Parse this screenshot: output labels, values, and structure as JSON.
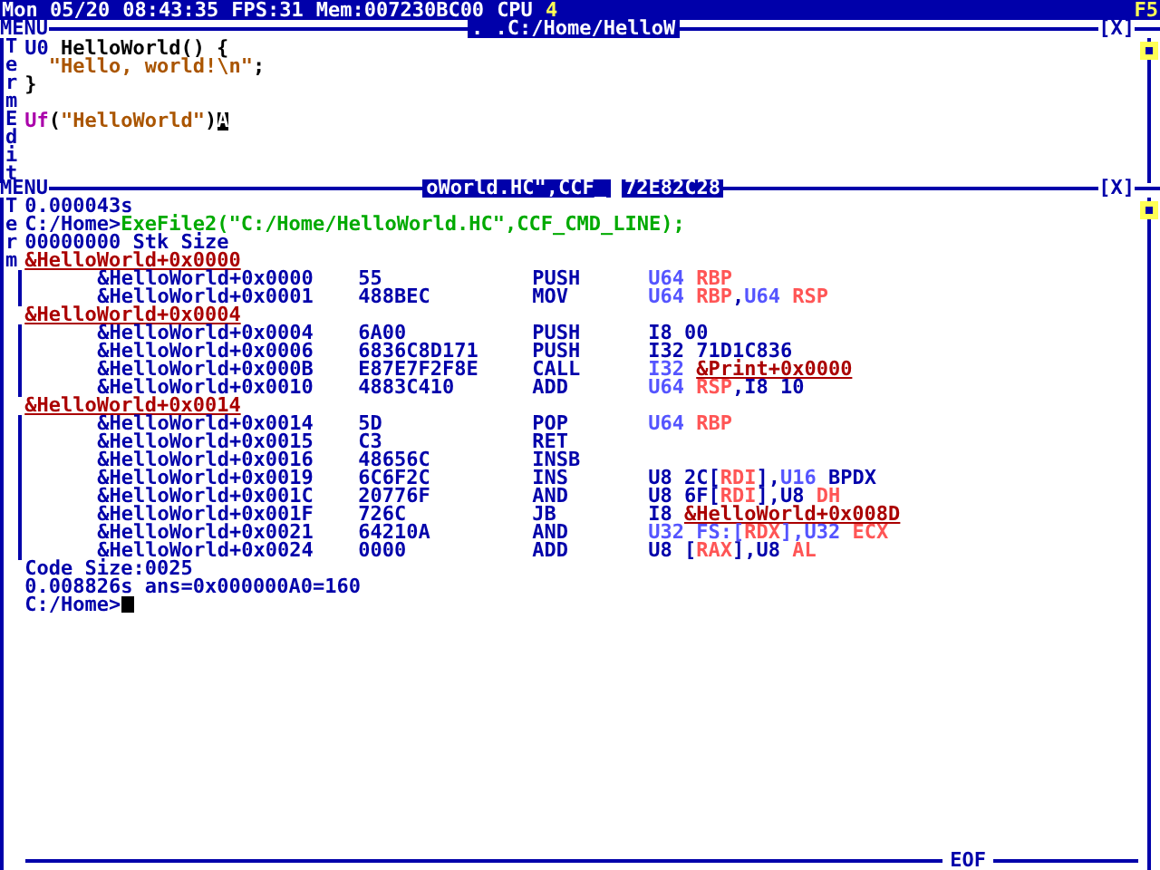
{
  "status_bar": {
    "date": "Mon 05/20",
    "time": "08:43:35",
    "fps": "FPS:31",
    "mem": "Mem:007230BC00",
    "cpu_label": "CPU",
    "cpu_count": "4",
    "right": "F5"
  },
  "editor_window": {
    "menu": "MENU",
    "title": ". .C:/Home/HelloW",
    "close": "[X]",
    "side_labels": [
      "Term",
      "Edit"
    ],
    "lines": [
      {
        "tokens": [
          {
            "kind": "type",
            "text": "U0"
          },
          {
            "kind": "text",
            "text": "HelloWorld() {"
          }
        ]
      },
      {
        "tokens": [
          {
            "kind": "string",
            "text": "  \"Hello, world!\\n\""
          },
          {
            "kind": "text",
            "text": ";"
          }
        ]
      },
      {
        "tokens": [
          {
            "kind": "text",
            "text": "}"
          }
        ]
      },
      {
        "blank_before": true,
        "tokens": [
          {
            "kind": "fn",
            "text": "Uf"
          },
          {
            "kind": "text",
            "text": "("
          },
          {
            "kind": "string",
            "text": "\"HelloWorld\""
          },
          {
            "kind": "text",
            "text": ")"
          },
          {
            "kind": "cursor",
            "text": "A"
          }
        ]
      }
    ]
  },
  "terminal_window": {
    "menu": "MENU",
    "title": "oWorld.HC\",CCF_",
    "title_2": "72E82C28",
    "close": "[X]",
    "side_label": "Term",
    "footer": "EOF",
    "time_1": "0.000043s",
    "prompt": "C:/Home>",
    "command": "ExeFile2(\"C:/Home/HelloWorld.HC\",CCF_CMD_LINE);",
    "stack": "00000000 Stk Size",
    "disassembly": [
      {
        "kind": "label",
        "text": "&HelloWorld+0x0000"
      },
      {
        "kind": "instr",
        "address": "&HelloWorld+0x0000",
        "bytes": "55",
        "mnemonic": "PUSH",
        "operands": [
          {
            "kind": "type",
            "text": "U64"
          },
          {
            "kind": "reg",
            "text": "RBP"
          }
        ]
      },
      {
        "kind": "instr",
        "address": "&HelloWorld+0x0001",
        "bytes": "488BEC",
        "mnemonic": "MOV",
        "operands": [
          {
            "kind": "type",
            "text": "U64"
          },
          {
            "kind": "reg",
            "text": "RBP"
          },
          {
            "kind": "plain",
            "text": ","
          },
          {
            "kind": "type",
            "text": "U64"
          },
          {
            "kind": "reg",
            "text": "RSP"
          }
        ]
      },
      {
        "kind": "label",
        "text": "&HelloWorld+0x0004"
      },
      {
        "kind": "instr",
        "address": "&HelloWorld+0x0004",
        "bytes": "6A00",
        "mnemonic": "PUSH",
        "operands": [
          {
            "kind": "plain",
            "text": "I8 00"
          }
        ]
      },
      {
        "kind": "instr",
        "address": "&HelloWorld+0x0006",
        "bytes": "6836C8D171",
        "mnemonic": "PUSH",
        "operands": [
          {
            "kind": "plain",
            "text": "I32 71D1C836"
          }
        ]
      },
      {
        "kind": "instr",
        "address": "&HelloWorld+0x000B",
        "bytes": "E87E7F2F8E",
        "mnemonic": "CALL",
        "operands": [
          {
            "kind": "type",
            "text": "I32"
          },
          {
            "kind": "link",
            "text": "&Print+0x0000"
          }
        ]
      },
      {
        "kind": "instr",
        "address": "&HelloWorld+0x0010",
        "bytes": "4883C410",
        "mnemonic": "ADD",
        "operands": [
          {
            "kind": "type",
            "text": "U64"
          },
          {
            "kind": "reg",
            "text": "RSP"
          },
          {
            "kind": "plain",
            "text": ",I8 10"
          }
        ]
      },
      {
        "kind": "label",
        "text": "&HelloWorld+0x0014"
      },
      {
        "kind": "instr",
        "address": "&HelloWorld+0x0014",
        "bytes": "5D",
        "mnemonic": "POP",
        "operands": [
          {
            "kind": "type",
            "text": "U64"
          },
          {
            "kind": "reg",
            "text": "RBP"
          }
        ]
      },
      {
        "kind": "instr",
        "address": "&HelloWorld+0x0015",
        "bytes": "C3",
        "mnemonic": "RET"
      },
      {
        "kind": "instr",
        "address": "&HelloWorld+0x0016",
        "bytes": "48656C",
        "mnemonic": "INSB"
      },
      {
        "kind": "instr",
        "address": "&HelloWorld+0x0019",
        "bytes": "6C6F2C",
        "mnemonic": "INS",
        "operands": [
          {
            "kind": "plain",
            "text": "U8 2C["
          },
          {
            "kind": "reg",
            "text": "RDI"
          },
          {
            "kind": "plain",
            "text": "],"
          },
          {
            "kind": "type",
            "text": "U16"
          },
          {
            "kind": "plain",
            "text": "BPDX"
          }
        ]
      },
      {
        "kind": "instr",
        "address": "&HelloWorld+0x001C",
        "bytes": "20776F",
        "mnemonic": "AND",
        "operands": [
          {
            "kind": "plain",
            "text": "U8 6F["
          },
          {
            "kind": "reg",
            "text": "RDI"
          },
          {
            "kind": "plain",
            "text": "],"
          },
          {
            "kind": "word",
            "text": "U8"
          },
          {
            "kind": "reg",
            "text": "DH"
          }
        ]
      },
      {
        "kind": "instr",
        "address": "&HelloWorld+0x001F",
        "bytes": "726C",
        "mnemonic": "JB",
        "operands": [
          {
            "kind": "word",
            "text": "I8"
          },
          {
            "kind": "link",
            "text": "&HelloWorld+0x008D"
          }
        ]
      },
      {
        "kind": "instr",
        "address": "&HelloWorld+0x0021",
        "bytes": "64210A",
        "mnemonic": "AND",
        "operands": [
          {
            "kind": "type",
            "text": "U32"
          },
          {
            "kind": "seg",
            "text": "FS:["
          },
          {
            "kind": "reg",
            "text": "RDX"
          },
          {
            "kind": "seg",
            "text": "],"
          },
          {
            "kind": "type",
            "text": "U32"
          },
          {
            "kind": "reg",
            "text": "ECX"
          }
        ]
      },
      {
        "kind": "instr",
        "address": "&HelloWorld+0x0024",
        "bytes": "0000",
        "mnemonic": "ADD",
        "operands": [
          {
            "kind": "plain",
            "text": "U8 ["
          },
          {
            "kind": "reg",
            "text": "RAX"
          },
          {
            "kind": "plain",
            "text": "],"
          },
          {
            "kind": "word",
            "text": "U8"
          },
          {
            "kind": "reg",
            "text": "AL"
          }
        ]
      }
    ],
    "code_size": "Code Size:0025",
    "result": "0.008826s ans=0x000000A0=160",
    "prompt_2": "C:/Home>"
  }
}
